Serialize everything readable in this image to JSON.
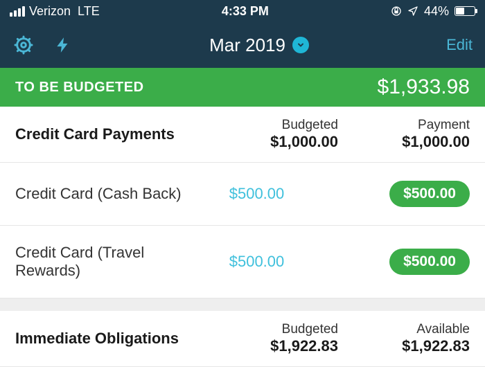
{
  "status": {
    "carrier": "Verizon",
    "network": "LTE",
    "time": "4:33 PM",
    "battery_pct": "44%"
  },
  "nav": {
    "month": "Mar 2019",
    "edit": "Edit"
  },
  "tbb": {
    "label": "TO BE BUDGETED",
    "amount": "$1,933.98"
  },
  "groups": [
    {
      "name": "Credit Card Payments",
      "col1_label": "Budgeted",
      "col1_value": "$1,000.00",
      "col2_label": "Payment",
      "col2_value": "$1,000.00",
      "categories": [
        {
          "name": "Credit Card (Cash Back)",
          "budgeted": "$500.00",
          "available": "$500.00"
        },
        {
          "name": "Credit Card (Travel Rewards)",
          "budgeted": "$500.00",
          "available": "$500.00"
        }
      ]
    },
    {
      "name": "Immediate Obligations",
      "col1_label": "Budgeted",
      "col1_value": "$1,922.83",
      "col2_label": "Available",
      "col2_value": "$1,922.83",
      "categories": []
    }
  ]
}
